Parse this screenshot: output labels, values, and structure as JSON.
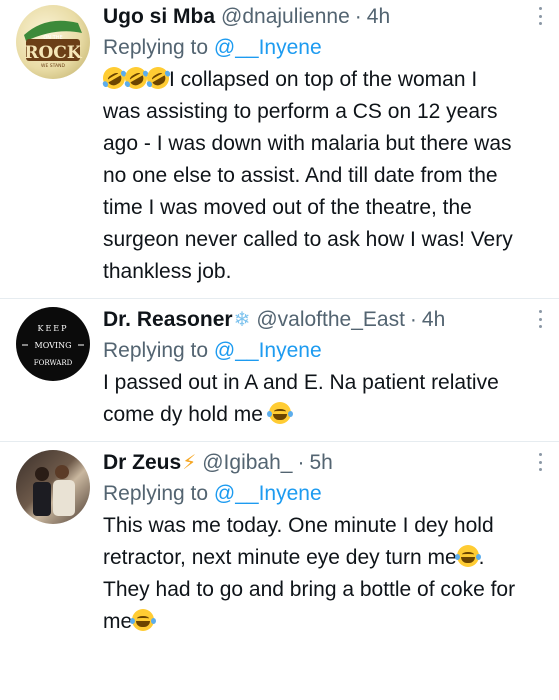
{
  "tweets": [
    {
      "name": "Ugo si Mba",
      "handle": "@dnajulienne",
      "separator": "·",
      "time": "4h",
      "replying_prefix": "Replying to",
      "replying_to": "@__Inyene",
      "body_emojis": "rolling-on-floor-laughing x3",
      "body": "I collapsed on top of the woman I was assisting to perform a CS on 12 years ago - I was down with malaria but there was no one else to assist. And till date from the time I was moved out of the theatre, the surgeon never called to ask how I was! Very thankless job.",
      "avatar_text_top": "ON THE",
      "avatar_text": "ROCK",
      "avatar_text_bottom": "WE STAND"
    },
    {
      "name": "Dr. Reasoner",
      "name_icon": "❄",
      "handle": "@valofthe_East",
      "separator": "·",
      "time": "4h",
      "replying_prefix": "Replying to",
      "replying_to": "@__Inyene",
      "body": "I passed out in A and E. Na patient relative come dy hold me",
      "avatar_line1": "KEEP",
      "avatar_line2": "MOVING",
      "avatar_line3": "FORWARD"
    },
    {
      "name": "Dr Zeus",
      "name_icon": "⚡",
      "handle": "@Igibah_",
      "separator": "·",
      "time": "5h",
      "replying_prefix": "Replying to",
      "replying_to": "@__Inyene",
      "body_part1": "This was me today. One minute I dey hold retractor, next minute eye dey turn me",
      "body_part2": ". They had to go and bring a bottle of coke for me"
    }
  ],
  "colors": {
    "link": "#1d9bf0",
    "secondary": "#536471",
    "text": "#0f1419",
    "divider": "#e6ecf0"
  }
}
